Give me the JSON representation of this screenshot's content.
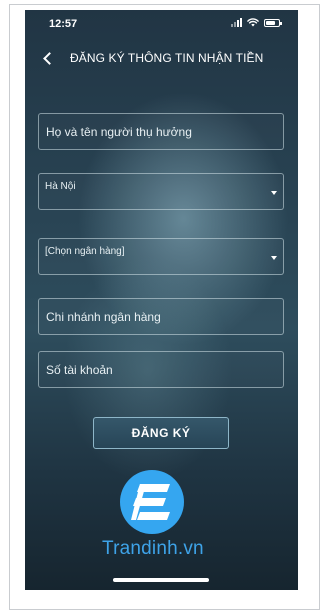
{
  "status_bar": {
    "time": "12:57",
    "icons": [
      "signal-icon",
      "wifi-icon",
      "battery-icon"
    ]
  },
  "nav": {
    "back_icon": "chevron-left-icon",
    "title": "ĐĂNG KÝ THÔNG TIN NHẬN TIỀN"
  },
  "form": {
    "beneficiary_name_placeholder": "Họ và tên người thụ hưởng",
    "city_value": "Hà Nội",
    "bank_value": "[Chọn ngân hàng]",
    "branch_placeholder": "Chi nhánh ngân hàng",
    "account_number_placeholder": "Số tài khoản",
    "submit_label": "ĐĂNG KÝ"
  },
  "watermark": {
    "text": "Trandinh.vn"
  },
  "colors": {
    "background_top": "#213544",
    "background_mid": "#2e4d5d",
    "accent": "#3ea3e8",
    "text": "#ffffff",
    "field_border": "#d2e1e8"
  }
}
